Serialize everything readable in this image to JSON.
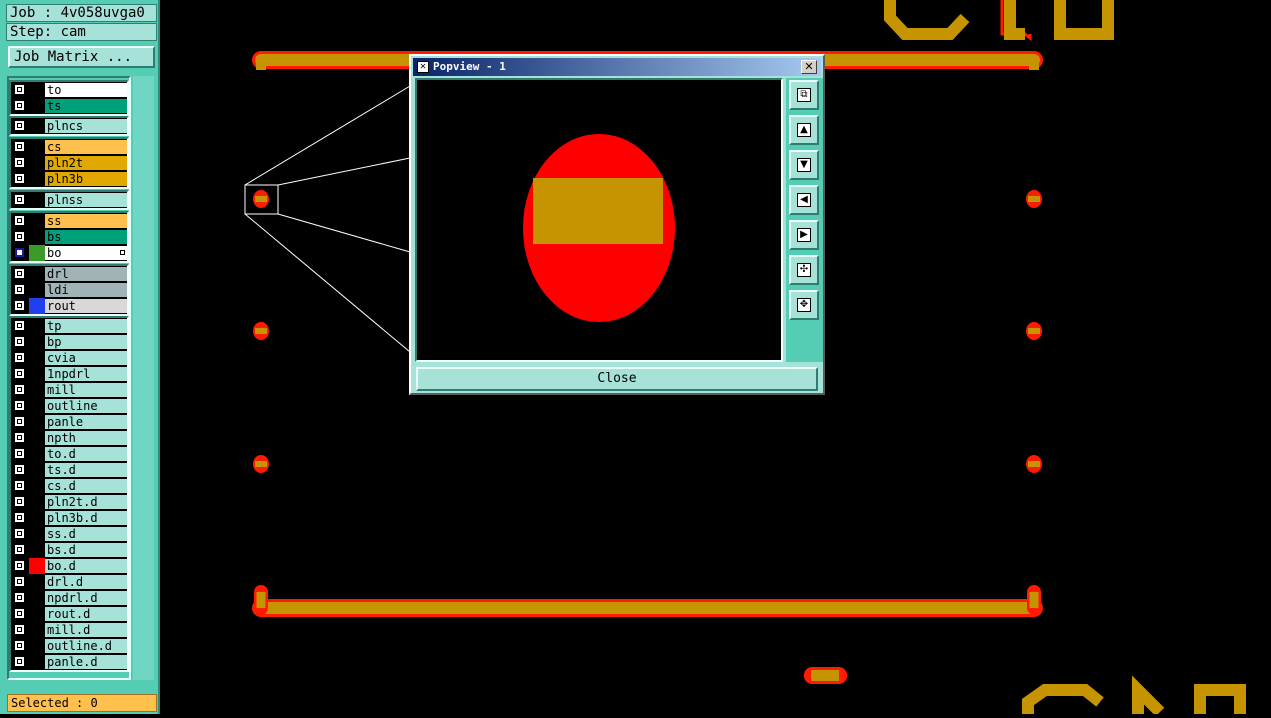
{
  "job": {
    "line": "Job : 4v058uvga0",
    "step": "Step: cam"
  },
  "job_matrix_label": "Job Matrix ...",
  "layers": [
    {
      "name": "to",
      "color": "#ffffff",
      "swatch": "#000000"
    },
    {
      "name": "ts",
      "color": "#00a07a",
      "swatch": "#000000"
    },
    {
      "name": "plncs",
      "color": "#a6e2d7",
      "swatch": "#000000"
    },
    {
      "name": "cs",
      "color": "#ffc04d",
      "swatch": "#000000"
    },
    {
      "name": "pln2t",
      "color": "#e0a800",
      "swatch": "#000000"
    },
    {
      "name": "pln3b",
      "color": "#e0a800",
      "swatch": "#000000"
    },
    {
      "name": "plnss",
      "color": "#a6e2d7",
      "swatch": "#000000"
    },
    {
      "name": "ss",
      "color": "#ffc04d",
      "swatch": "#000000"
    },
    {
      "name": "bs",
      "color": "#00a07a",
      "swatch": "#000000"
    },
    {
      "name": "bo",
      "color": "#ffffff",
      "swatch": "#3a9a2a",
      "selected": true
    },
    {
      "name": "drl",
      "color": "#a0b4b8",
      "swatch": "#000000"
    },
    {
      "name": "ldi",
      "color": "#a0b4b8",
      "swatch": "#000000"
    },
    {
      "name": "rout",
      "color": "#d8d8d8",
      "swatch": "#2040f0"
    },
    {
      "name": "tp",
      "color": "#a6e2d7",
      "swatch": "#000000"
    },
    {
      "name": "bp",
      "color": "#a6e2d7",
      "swatch": "#000000"
    },
    {
      "name": "cvia",
      "color": "#a6e2d7",
      "swatch": "#000000"
    },
    {
      "name": "1npdrl",
      "color": "#a6e2d7",
      "swatch": "#000000"
    },
    {
      "name": "mill",
      "color": "#a6e2d7",
      "swatch": "#000000"
    },
    {
      "name": "outline",
      "color": "#a6e2d7",
      "swatch": "#000000"
    },
    {
      "name": "panle",
      "color": "#a6e2d7",
      "swatch": "#000000"
    },
    {
      "name": "npth",
      "color": "#a6e2d7",
      "swatch": "#000000"
    },
    {
      "name": "to.d",
      "color": "#a6e2d7",
      "swatch": "#000000"
    },
    {
      "name": "ts.d",
      "color": "#a6e2d7",
      "swatch": "#000000"
    },
    {
      "name": "cs.d",
      "color": "#a6e2d7",
      "swatch": "#000000"
    },
    {
      "name": "pln2t.d",
      "color": "#a6e2d7",
      "swatch": "#000000"
    },
    {
      "name": "pln3b.d",
      "color": "#a6e2d7",
      "swatch": "#000000"
    },
    {
      "name": "ss.d",
      "color": "#a6e2d7",
      "swatch": "#000000"
    },
    {
      "name": "bs.d",
      "color": "#a6e2d7",
      "swatch": "#000000"
    },
    {
      "name": "bo.d",
      "color": "#a6e2d7",
      "swatch": "#ff0000"
    },
    {
      "name": "drl.d",
      "color": "#a6e2d7",
      "swatch": "#000000"
    },
    {
      "name": "npdrl.d",
      "color": "#a6e2d7",
      "swatch": "#000000"
    },
    {
      "name": "rout.d",
      "color": "#a6e2d7",
      "swatch": "#000000"
    },
    {
      "name": "mill.d",
      "color": "#a6e2d7",
      "swatch": "#000000"
    },
    {
      "name": "outline.d",
      "color": "#a6e2d7",
      "swatch": "#000000"
    },
    {
      "name": "panle.d",
      "color": "#a6e2d7",
      "swatch": "#000000"
    }
  ],
  "selected_status": "Selected : 0",
  "popup": {
    "title": "Popview - 1",
    "close_label": "Close",
    "tools": [
      "zoom-home-icon",
      "pan-up-icon",
      "pan-down-icon",
      "pan-left-icon",
      "pan-right-icon",
      "zoom-out-icon",
      "zoom-in-icon"
    ]
  },
  "colors": {
    "pad_copper": "#c59400",
    "pad_outline": "#ff0000",
    "panel_bg": "#55cdb5"
  }
}
